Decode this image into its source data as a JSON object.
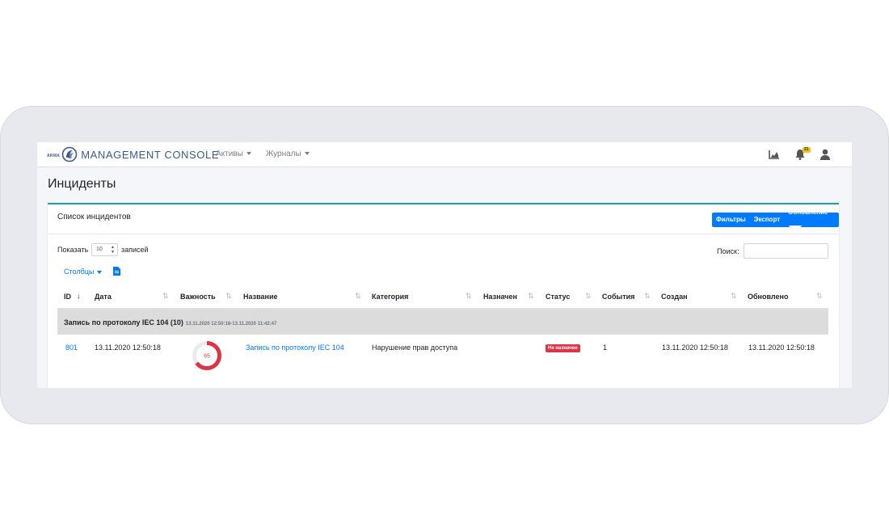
{
  "brand": {
    "small_text": "ARMA",
    "title": "MANAGEMENT CONSOLE",
    "color": "#3b5a8c"
  },
  "nav": {
    "menus": [
      {
        "label": "Активы"
      },
      {
        "label": "Журналы"
      }
    ],
    "icons": [
      "chart-icon",
      "bell-icon",
      "user-icon"
    ],
    "notification_count": "21"
  },
  "page": {
    "title": "Инциденты"
  },
  "card": {
    "title": "Список инцидентов",
    "buttons": {
      "filters": "Фильтры",
      "export": "Экспорт",
      "refresh": "Обновление"
    }
  },
  "table_controls": {
    "show_label": "Показать",
    "page_length": "10",
    "records_label": "записей",
    "search_label": "Поиск:",
    "search_value": "",
    "columns_button": "Столбцы"
  },
  "table": {
    "columns": [
      "ID",
      "Дата",
      "Важность",
      "Название",
      "Категория",
      "Назначен",
      "Статус",
      "События",
      "Создан",
      "Обновлено"
    ],
    "group": {
      "title": "Запись по протоколу IEC 104 (10)",
      "range": "13.11.2020 12:50:18-13.11.2020 11:42:47"
    },
    "rows": [
      {
        "id": "801",
        "date": "13.11.2020 12:50:18",
        "severity": 65,
        "name": "Запись по протоколу IEC 104",
        "category": "Нарушение прав доступа",
        "assigned": "",
        "status": "Не назначен",
        "events": "1",
        "created": "13.11.2020 12:50:18",
        "updated": "13.11.2020 12:50:18"
      }
    ]
  },
  "colors": {
    "primary": "#007bff",
    "danger": "#dc3545",
    "card_accent": "#17a2b8",
    "badge": "#f4c01b",
    "group_bg": "#dcdcdc"
  }
}
